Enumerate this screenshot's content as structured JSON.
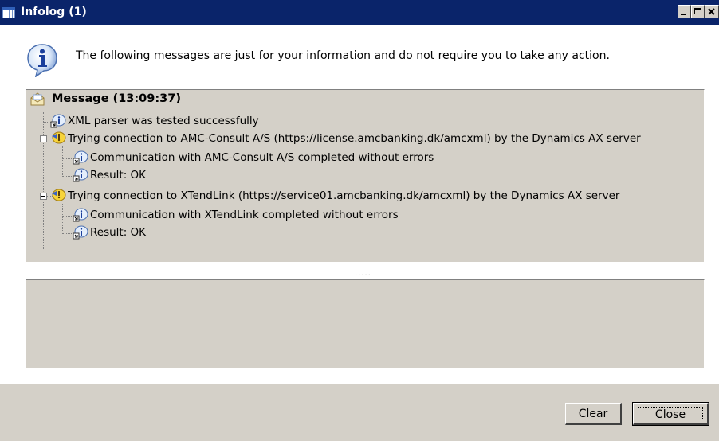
{
  "window": {
    "title": "Infolog (1)"
  },
  "header": {
    "text": "The following messages are just for your information and do not require you to take any action."
  },
  "tree": {
    "root": {
      "label": "Message (13:09:37)"
    },
    "items": [
      {
        "label": "XML parser was tested successfully"
      },
      {
        "label": "Trying connection to AMC-Consult A/S (https://license.amcbanking.dk/amcxml) by the Dynamics AX server",
        "children": [
          {
            "label": "Communication with AMC-Consult A/S completed without errors"
          },
          {
            "label": "Result: OK"
          }
        ]
      },
      {
        "label": "Trying connection to XTendLink (https://service01.amcbanking.dk/amcxml) by the Dynamics AX server",
        "children": [
          {
            "label": "Communication with XTendLink  completed without errors"
          },
          {
            "label": "Result: OK"
          }
        ]
      }
    ]
  },
  "splitter": {
    "grip": "....."
  },
  "buttons": {
    "clear": "Clear",
    "close": "Close"
  },
  "icons": {
    "title": "infolog-icon",
    "info": "info-icon",
    "message": "envelope-icon",
    "tree_info": "info-bubble-icon",
    "tree_warning": "warning-bubble-icon"
  },
  "colors": {
    "titlebar": "#0a246a",
    "face": "#d4d0c8"
  }
}
